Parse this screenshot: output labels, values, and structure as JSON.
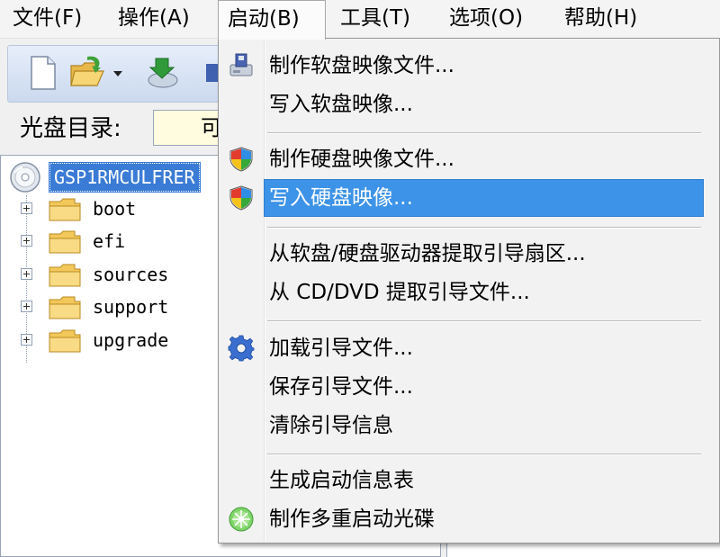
{
  "menubar": {
    "items": [
      {
        "label": "文件(F)"
      },
      {
        "label": "操作(A)"
      },
      {
        "label": "启动(B)"
      },
      {
        "label": "工具(T)"
      },
      {
        "label": "选项(O)"
      },
      {
        "label": "帮助(H)"
      }
    ]
  },
  "toolbar": {
    "icons": [
      "new-file-icon",
      "open-folder-icon",
      "dropdown-arrow-icon",
      "extract-icon",
      "save-icon"
    ]
  },
  "address": {
    "label": "光盘目录:",
    "value": "可"
  },
  "tree": {
    "root": "GSP1RMCULFRER",
    "folders": [
      "boot",
      "efi",
      "sources",
      "support",
      "upgrade"
    ]
  },
  "boot_menu": {
    "items": [
      {
        "label": "制作软盘映像文件...",
        "icon": "floppy-image-icon"
      },
      {
        "label": "写入软盘映像...",
        "icon": ""
      },
      {
        "label": "制作硬盘映像文件...",
        "icon": "uac-shield-icon"
      },
      {
        "label": "写入硬盘映像...",
        "icon": "uac-shield-icon",
        "highlighted": true
      },
      {
        "label": "从软盘/硬盘驱动器提取引导扇区...",
        "icon": ""
      },
      {
        "label": "从 CD/DVD 提取引导文件...",
        "icon": ""
      },
      {
        "label": "加载引导文件...",
        "icon": "gear-icon"
      },
      {
        "label": "保存引导文件...",
        "icon": ""
      },
      {
        "label": "清除引导信息",
        "icon": ""
      },
      {
        "label": "生成启动信息表",
        "icon": ""
      },
      {
        "label": "制作多重启动光碟",
        "icon": "multi-boot-disc-icon"
      }
    ]
  },
  "colors": {
    "highlight": "#3d93e8",
    "selection": "#3a7bd5",
    "address_bg": "#fffce0"
  }
}
